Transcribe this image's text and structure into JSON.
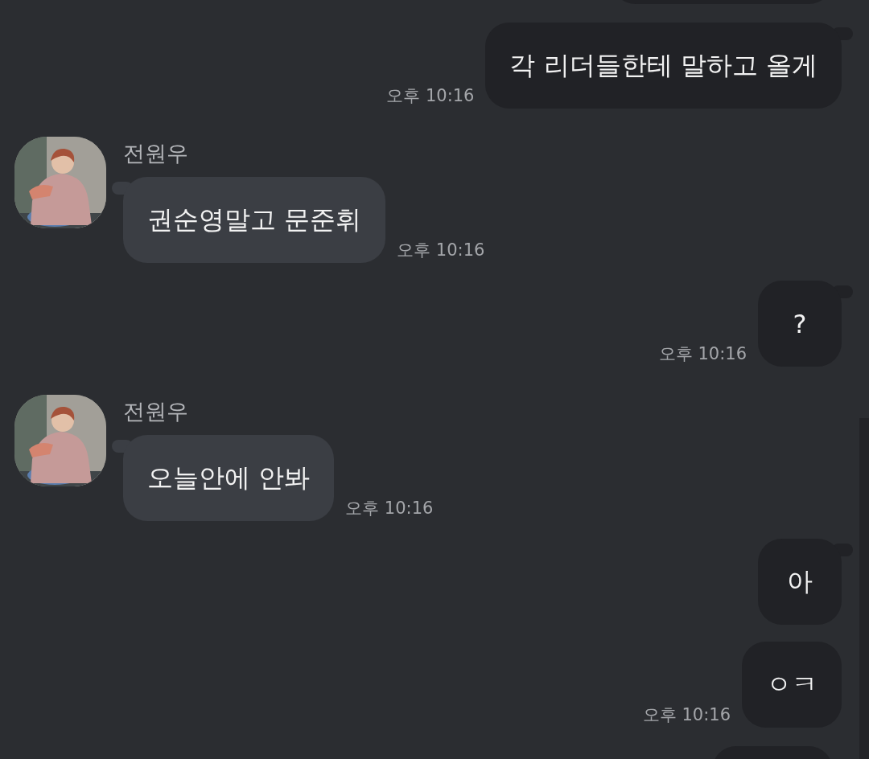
{
  "messages": [
    {
      "kind": "clipped"
    },
    {
      "kind": "outgoing",
      "text": "각 리더들한테 말하고 올게",
      "time": "오후 10:16",
      "tail": true
    },
    {
      "kind": "incoming",
      "sender": "전원우",
      "text": "권순영말고 문준휘",
      "time": "오후 10:16",
      "tail": true
    },
    {
      "kind": "outgoing",
      "text": "?",
      "time": "오후 10:16",
      "tail": true
    },
    {
      "kind": "incoming",
      "sender": "전원우",
      "text": "오늘안에 안봐",
      "time": "오후 10:16",
      "tail": true
    },
    {
      "kind": "outgoing",
      "text": "아",
      "tail": true
    },
    {
      "kind": "outgoing",
      "text": "ㅇㅋ",
      "time": "오후 10:16",
      "tail": false
    },
    {
      "kind": "clipped"
    }
  ]
}
